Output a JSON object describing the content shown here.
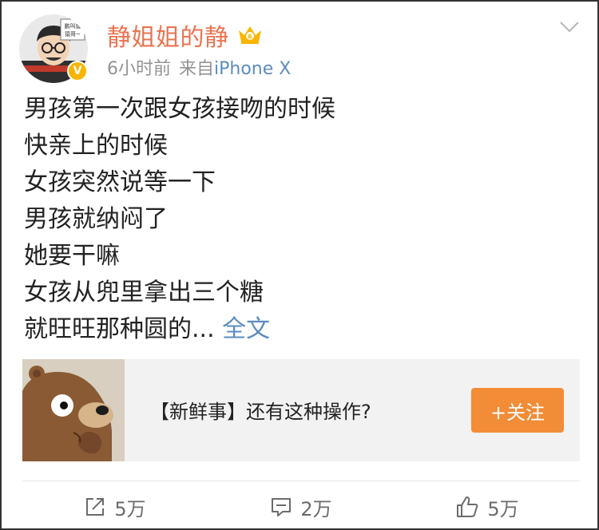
{
  "post": {
    "author": {
      "name": "静姐姐的静",
      "avatar_sign_text": [
        "鹏叫兽",
        "猿哥~"
      ],
      "verified_badge": "V",
      "crown_icon": "crown-icon",
      "crown_color": "#f7b500"
    },
    "meta": {
      "time": "6小时前",
      "from_label": "来自",
      "device": "iPhone X"
    },
    "text_lines": [
      "男孩第一次跟女孩接吻的时候",
      "快亲上的时候",
      "女孩突然说等一下",
      "男孩就纳闷了",
      "她要干嘛",
      "女孩从兜里拿出三个糖",
      "就旺旺那种圆的..."
    ],
    "full_text_link": "全文"
  },
  "card": {
    "title": "【新鲜事】还有这种操作?",
    "follow_button": "+关注",
    "button_color": "#f28c37"
  },
  "actions": {
    "repost": {
      "icon": "repost-icon",
      "count": "5万"
    },
    "comment": {
      "icon": "comment-icon",
      "count": "2万"
    },
    "like": {
      "icon": "thumbs-up-icon",
      "count": "5万"
    }
  },
  "colors": {
    "username": "#eb7350",
    "link": "#5d8cbe",
    "meta": "#939393"
  }
}
